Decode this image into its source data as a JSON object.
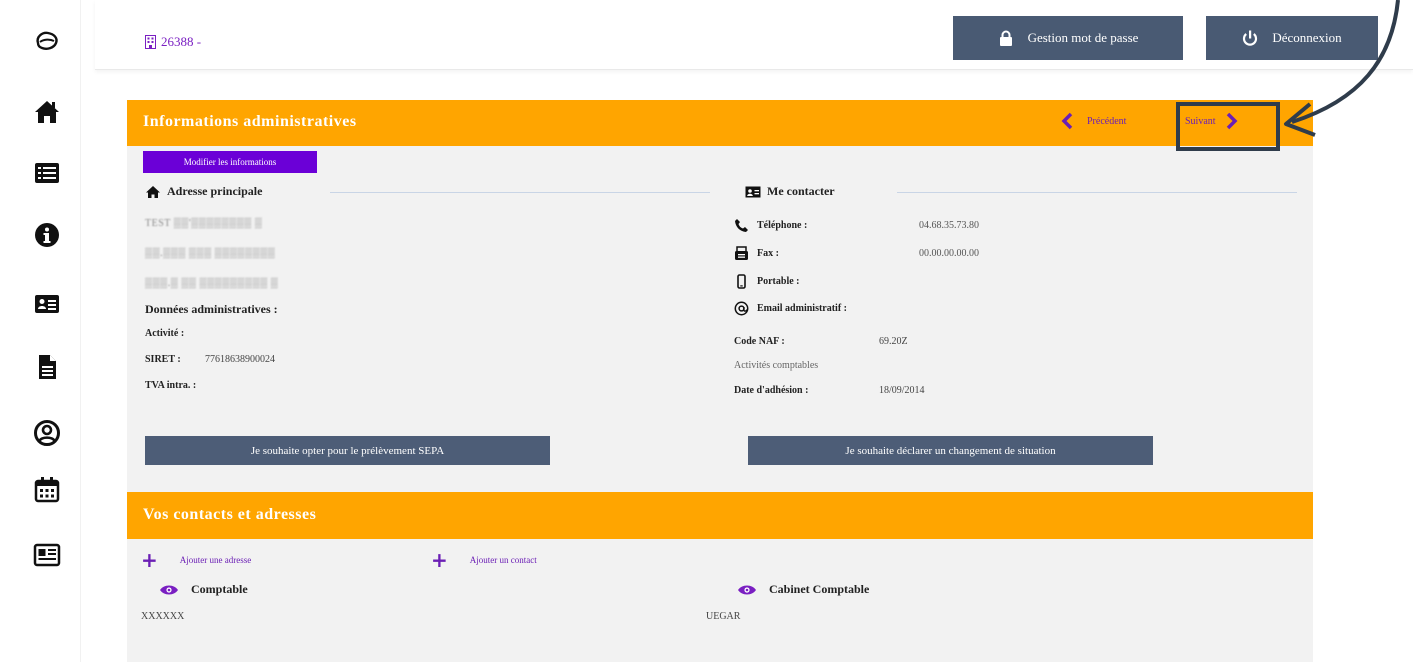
{
  "header": {
    "account_id": "26388 -",
    "password_button": "Gestion mot de passe",
    "logout_button": "Déconnexion"
  },
  "sidebar": {
    "items": [
      {
        "icon": "brand-logo-icon"
      },
      {
        "icon": "home-icon"
      },
      {
        "icon": "list-icon"
      },
      {
        "icon": "info-icon"
      },
      {
        "icon": "id-card-icon"
      },
      {
        "icon": "document-icon"
      },
      {
        "icon": "user-circle-icon"
      },
      {
        "icon": "calendar-icon"
      },
      {
        "icon": "newspaper-icon"
      }
    ]
  },
  "admin": {
    "title": "Informations administratives",
    "prev_label": "Précédent",
    "next_label": "Suivant",
    "modify_button": "Modifier les informations",
    "address_title": "Adresse principale",
    "address_lines": [
      "TEST ▒▒'▒▒▒▒▒▒▒▒ ▒",
      "▒▒.▒▒▒ ▒▒▒ ▒▒▒▒▒▒▒▒",
      "▒▒▒.▒ ▒▒ ▒▒▒▒▒▒▒▒▒ ▒"
    ],
    "admin_data_title": "Données administratives :",
    "activite_label": "Activité :",
    "siret_label": "SIRET :",
    "siret_value": "77618638900024",
    "tva_label": "TVA intra. :",
    "contact_title": "Me contacter",
    "phone_label": "Téléphone :",
    "phone_value": "04.68.35.73.80",
    "fax_label": "Fax :",
    "fax_value": "00.00.00.00.00",
    "mobile_label": "Portable :",
    "email_label": "Email administratif :",
    "naf_label": "Code NAF :",
    "naf_value": "69.20Z",
    "naf_desc": "Activités comptables",
    "adhesion_label": "Date d'adhésion :",
    "adhesion_value": "18/09/2014",
    "sepa_button": "Je souhaite opter pour le prélèvement SEPA",
    "change_button": "Je souhaite déclarer un changement de situation"
  },
  "contacts": {
    "title": "Vos contacts et adresses",
    "add_address": "Ajouter une adresse",
    "add_contact": "Ajouter un contact",
    "cards": [
      {
        "title": "Comptable",
        "value": "XXXXXX"
      },
      {
        "title": "Cabinet Comptable",
        "value": "UEGAR"
      }
    ]
  },
  "colors": {
    "accent_orange": "#ffa500",
    "purple": "#6b00d7",
    "button_slate": "#495a73",
    "panel_bg": "#f2f2f2"
  }
}
